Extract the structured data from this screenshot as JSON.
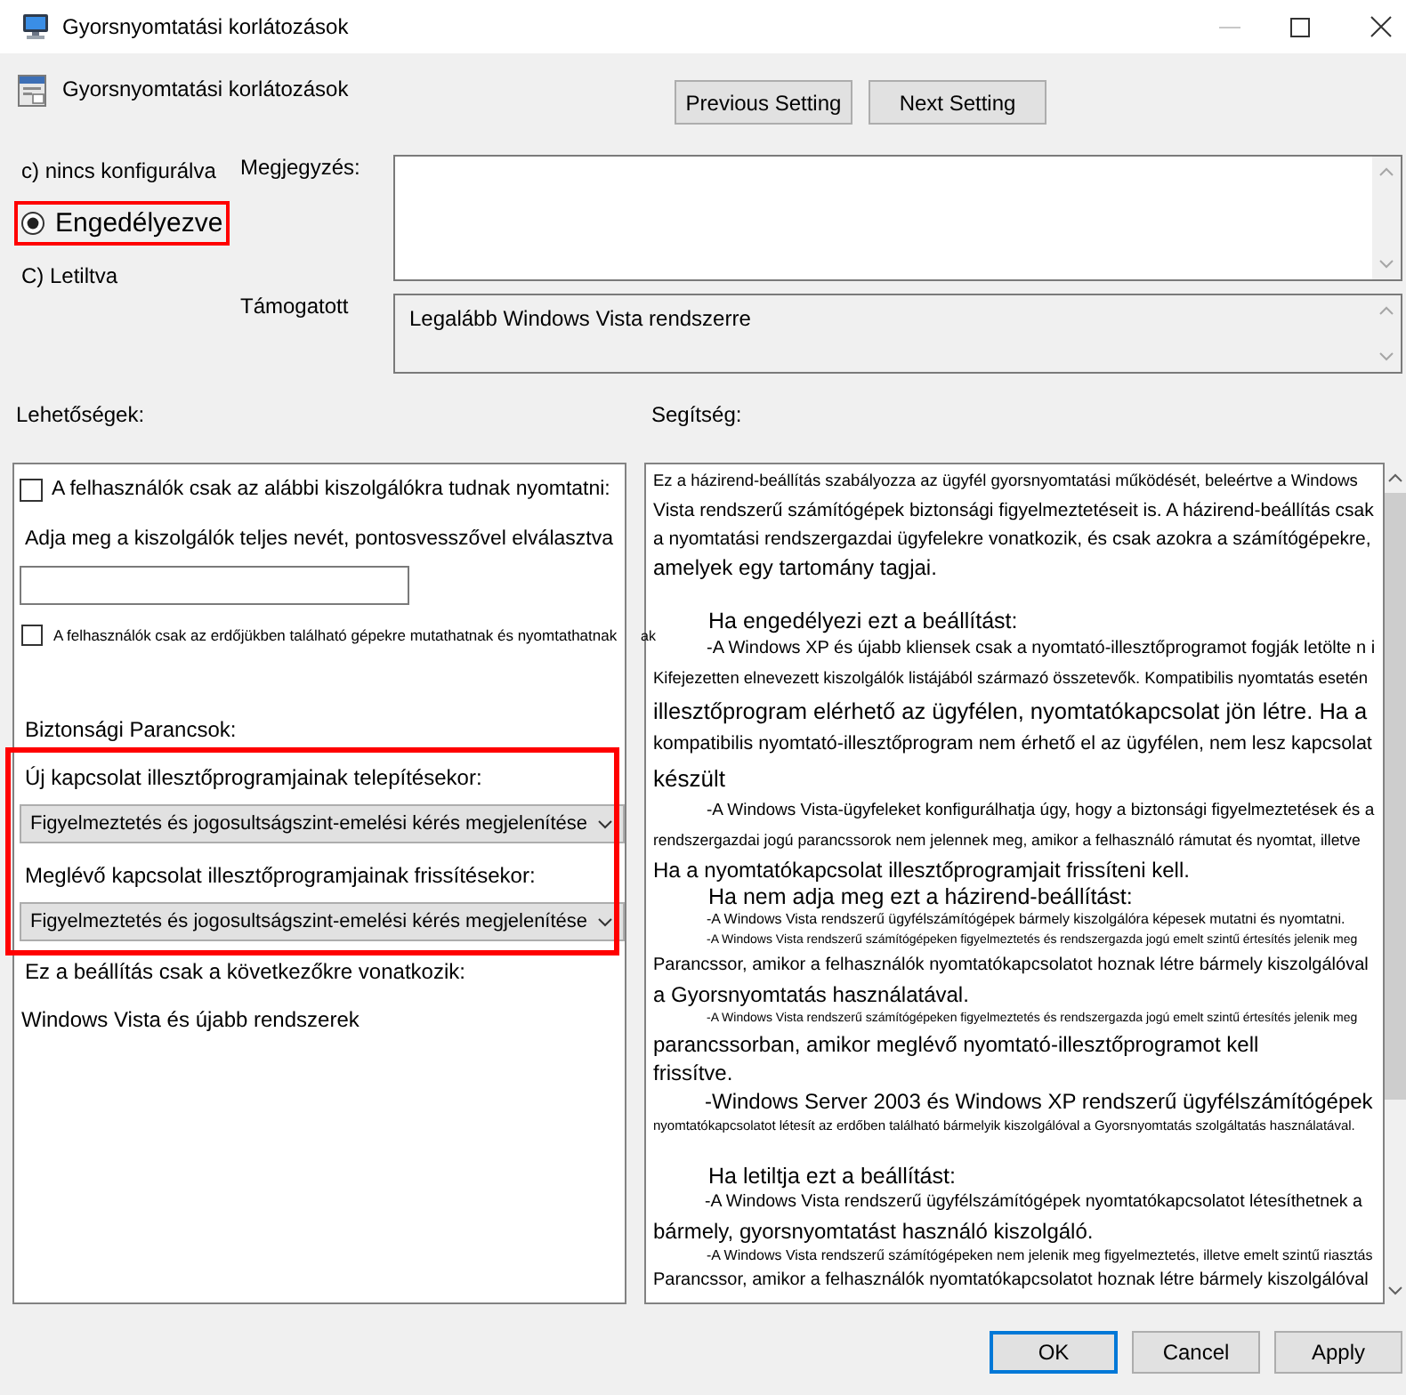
{
  "window": {
    "title": "Gyorsnyomtatási korlátozások"
  },
  "header": {
    "title": "Gyorsnyomtatási korlátozások",
    "buttons": [
      "Previous Setting",
      "Next Setting"
    ]
  },
  "states": [
    {
      "label": "c) nincs konfigurálva",
      "selected": false,
      "highlighted": false
    },
    {
      "label": "Engedélyezve",
      "selected": true,
      "highlighted": true
    },
    {
      "label": "C) Letiltva",
      "selected": false,
      "highlighted": false
    }
  ],
  "comment": {
    "label": "Megjegyzés:"
  },
  "supported": {
    "label": "Támogatott",
    "value": "Legalább Windows Vista rendszerre"
  },
  "options": {
    "title": "Lehetőségek:",
    "items": [
      {
        "kind": "checkbox",
        "label": "A felhasználók csak az alábbi kiszolgálókra tudnak nyomtatni:",
        "checked": false
      },
      {
        "kind": "label",
        "label": "Adja meg a kiszolgálók teljes nevét, pontosvesszővel elválasztva"
      },
      {
        "kind": "input"
      },
      {
        "kind": "checkbox_small",
        "label": "A felhasználók csak az erdőjükben található gépekre mutathatnak és nyomtathatnak",
        "checked": false
      },
      {
        "kind": "section",
        "label": "Biztonsági Parancsok:"
      },
      {
        "kind": "group",
        "highlighted": true,
        "items": [
          {
            "kind": "label",
            "label": "Új kapcsolat illesztőprogramjainak telepítésekor:"
          },
          {
            "kind": "dropdown",
            "value": "Figyelmeztetés és jogosultságszint-emelési kérés megjelenítése"
          },
          {
            "kind": "label",
            "label": "Meglévő kapcsolat illesztőprogramjainak frissítésekor:"
          },
          {
            "kind": "dropdown",
            "value": "Figyelmeztetés és jogosultságszint-emelési kérés megjelenítése"
          }
        ]
      },
      {
        "kind": "label",
        "label": "Ez a beállítás csak a következőkre vonatkozik:"
      },
      {
        "kind": "value",
        "label": "Windows Vista és újabb rendszerek"
      }
    ]
  },
  "help": {
    "title": "Segítség:",
    "fragment": "ak",
    "sections": [
      {
        "lines": [
          {
            "kind": "intro",
            "text": "Ez a házirend-beállítás szabályozza az ügyfél gyorsnyomtatási működését, beleértve a Windows"
          },
          {
            "kind": "body",
            "text": "Vista rendszerű számítógépek biztonsági figyelmeztetéseit is. A házirend-beállítás csak"
          },
          {
            "kind": "body",
            "text": "a nyomtatási rendszergazdai ügyfelekre vonatkozik, és csak azokra a számítógépekre,"
          },
          {
            "kind": "body",
            "text": "amelyek egy tartomány tagjai."
          }
        ]
      },
      {
        "lines": [
          {
            "kind": "heading",
            "text": "Ha engedélyezi ezt a beállítást:"
          },
          {
            "kind": "bullet_small",
            "text": "-A Windows XP és újabb kliensek csak a nyomtató-illesztőprogramot fogják letölte n i"
          },
          {
            "kind": "fine",
            "text": "Kifejezetten elnevezett kiszolgálók listájából származó összetevők. Kompatibilis nyomtatás esetén"
          },
          {
            "kind": "large",
            "text": "illesztőprogram elérhető az ügyfélen, nyomtatókapcsolat jön létre. Ha a"
          },
          {
            "kind": "large",
            "text": "kompatibilis nyomtató-illesztőprogram nem érhető el az ügyfélen, nem lesz kapcsolat"
          },
          {
            "kind": "large",
            "text": "készült"
          },
          {
            "kind": "bullet_small",
            "text": "-A Windows Vista-ügyfeleket konfigurálhatja úgy, hogy a biztonsági figyelmeztetések és a"
          },
          {
            "kind": "fine",
            "text": "rendszergazdai jogú parancssorok nem jelennek meg, amikor a felhasználó rámutat és nyomtat, illetve"
          },
          {
            "kind": "body",
            "text": "Ha a nyomtatókapcsolat illesztőprogramjait frissíteni kell."
          },
          {
            "kind": "heading",
            "text": "Ha nem adja meg ezt a házirend-beállítást:"
          },
          {
            "kind": "bullet_micro",
            "text": "-A Windows Vista rendszerű ügyfélszámítógépek bármely kiszolgálóra képesek mutatni és nyomtatni."
          },
          {
            "kind": "bullet_micro",
            "text": "-A Windows Vista rendszerű számítógépeken figyelmeztetés és rendszergazda jogú emelt szintű értesítés jelenik meg"
          },
          {
            "kind": "body",
            "text": "Parancssor, amikor a felhasználók nyomtatókapcsolatot hoznak létre bármely kiszolgálóval"
          },
          {
            "kind": "body",
            "text": "a Gyorsnyomtatás használatával."
          },
          {
            "kind": "bullet_micro",
            "text": "-A Windows Vista rendszerű számítógépeken figyelmeztetés és rendszergazda jogú emelt szintű értesítés jelenik meg"
          },
          {
            "kind": "body",
            "text": "parancssorban, amikor meglévő nyomtató-illesztőprogramot kell"
          },
          {
            "kind": "body",
            "text": "frissítve."
          },
          {
            "kind": "bullet",
            "text": "-Windows Server 2003 és Windows XP rendszerű ügyfélszámítógépek"
          },
          {
            "kind": "fine_micro",
            "text": "nyomtatókapcsolatot létesít az erdőben található bármelyik kiszolgálóval a Gyorsnyomtatás szolgáltatás használatával."
          }
        ]
      },
      {
        "lines": [
          {
            "kind": "heading",
            "text": "Ha letiltja ezt a beállítást:"
          },
          {
            "kind": "bullet",
            "text": "-A Windows Vista rendszerű ügyfélszámítógépek nyomtatókapcsolatot létesíthetnek a"
          },
          {
            "kind": "body",
            "text": "bármely, gyorsnyomtatást használó kiszolgáló."
          },
          {
            "kind": "bullet_micro",
            "text": "-A Windows Vista rendszerű számítógépeken nem jelenik meg figyelmeztetés, illetve emelt szintű riasztás"
          },
          {
            "kind": "body",
            "text": "Parancssor, amikor a felhasználók nyomtatókapcsolatot hoznak létre bármely kiszolgálóval"
          }
        ]
      }
    ]
  },
  "footer": {
    "buttons": [
      {
        "label": "OK",
        "default": true
      },
      {
        "label": "Cancel",
        "default": false
      },
      {
        "label": "Apply",
        "default": false
      }
    ]
  }
}
